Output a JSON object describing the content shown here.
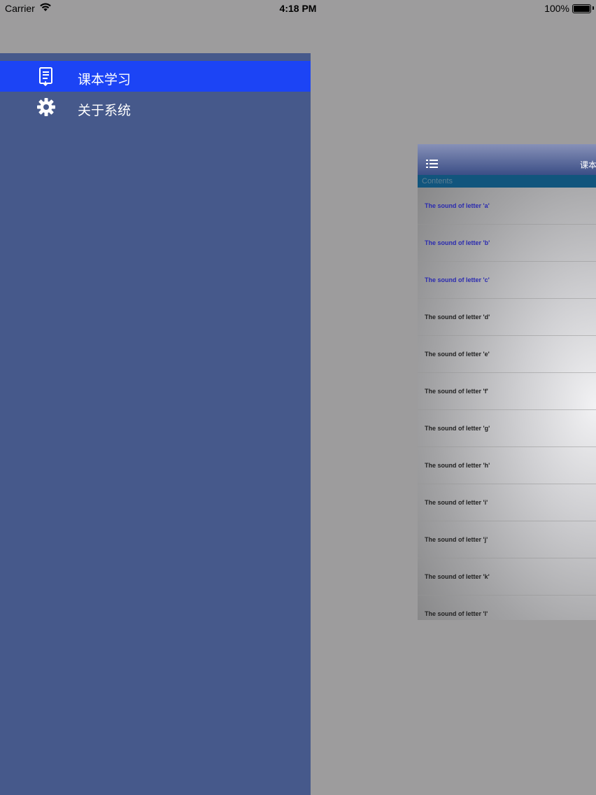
{
  "status_bar": {
    "carrier": "Carrier",
    "time": "4:18 PM",
    "battery": "100%"
  },
  "side_menu": {
    "items": [
      {
        "label": "课本学习",
        "icon": "book-icon",
        "active": true
      },
      {
        "label": "关于系统",
        "icon": "gear-icon",
        "active": false
      }
    ]
  },
  "content": {
    "nav_title": "课本",
    "section_header": "Contents",
    "rows": [
      "The sound of letter 'a'",
      "The sound of letter 'b'",
      "The sound of letter 'c'",
      "The sound of letter 'd'",
      "The sound of letter 'e'",
      "The sound of letter 'f'",
      "The sound of letter 'g'",
      "The sound of letter 'h'",
      "The sound of letter 'i'",
      "The sound of letter 'j'",
      "The sound of letter 'k'",
      "The sound of letter 'l'"
    ]
  },
  "colors": {
    "menu_bg": "#46598b",
    "menu_active": "#1c44f5",
    "visited_link": "#2b2bb0"
  }
}
